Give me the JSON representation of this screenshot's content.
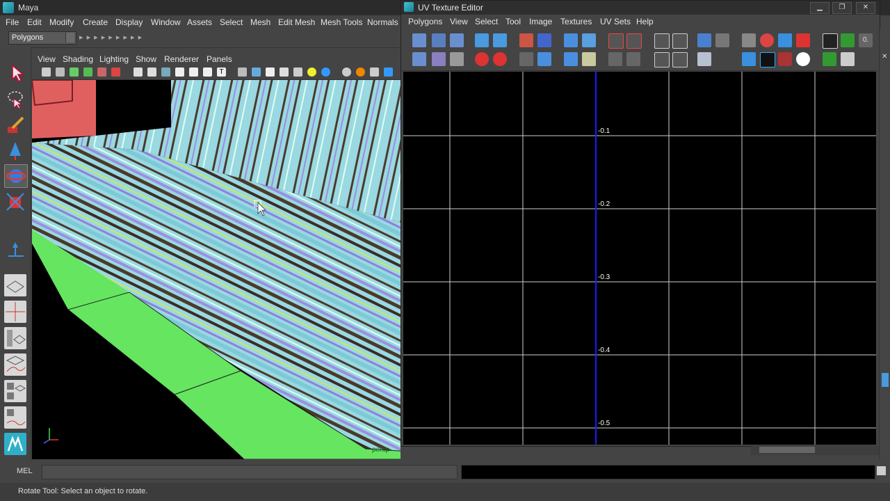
{
  "app": {
    "title": "Maya"
  },
  "menubar": [
    "File",
    "Edit",
    "Modify",
    "Create",
    "Display",
    "Window",
    "Assets",
    "Select",
    "Mesh",
    "Edit Mesh",
    "Mesh Tools",
    "Normals"
  ],
  "mode_selector": {
    "value": "Polygons"
  },
  "viewport": {
    "menu": [
      "View",
      "Shading",
      "Lighting",
      "Show",
      "Renderer",
      "Panels"
    ],
    "camera_label": "persp"
  },
  "uv_editor": {
    "title": "UV Texture Editor",
    "menu": [
      "Polygons",
      "View",
      "Select",
      "Tool",
      "Image",
      "Textures",
      "UV Sets",
      "Help"
    ],
    "grid_labels": [
      "-0.1",
      "-0.2",
      "-0.3",
      "-0.4",
      "-0.5"
    ],
    "window_buttons": [
      "minimize",
      "maximize",
      "close"
    ]
  },
  "side_value": "0.",
  "command_line": {
    "label": "MEL",
    "value": ""
  },
  "help_line": "Rotate Tool: Select an object to rotate.",
  "colors": {
    "background": "#444444",
    "viewport_bg": "#000000",
    "grid_line": "#d0d0d0",
    "uv_axis": "#1a1aff",
    "floor_green": "#66e560",
    "stripe_cyan": "#8fd8e0",
    "stripe_purple": "#9b8fe0"
  }
}
